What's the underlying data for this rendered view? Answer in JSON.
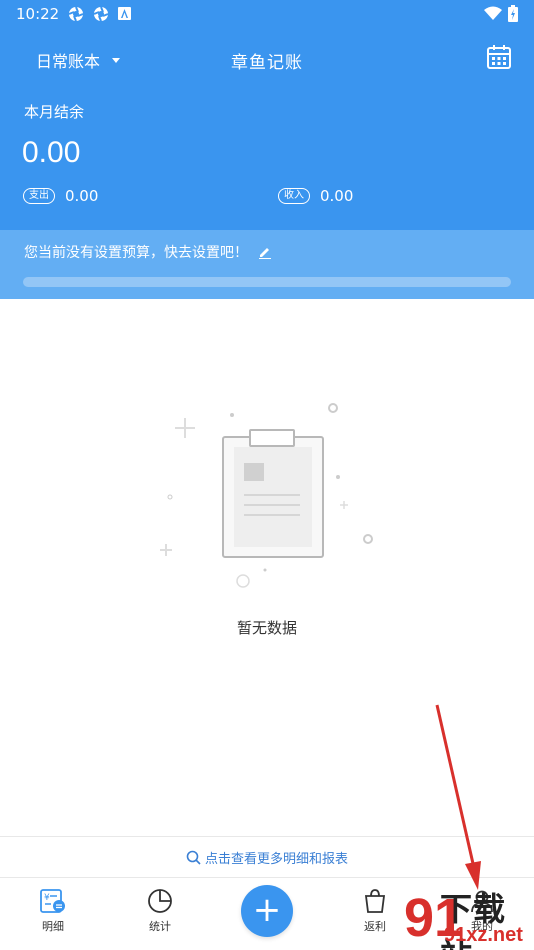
{
  "status_bar": {
    "time": "10:22"
  },
  "header": {
    "book_name": "日常账本",
    "app_title": "章鱼记账",
    "month_label": "本月结余",
    "balance": "0.00",
    "expense_label": "支出",
    "expense_value": "0.00",
    "income_label": "收入",
    "income_value": "0.00"
  },
  "budget": {
    "text": "您当前没有设置预算，快去设置吧！",
    "progress": 0
  },
  "empty": {
    "text": "暂无数据"
  },
  "more_link": "点击查看更多明细和报表",
  "tabs": {
    "details": "明细",
    "stats": "统计",
    "add": "+",
    "rebate": "返利",
    "mine": "我的"
  },
  "watermark": {
    "big": "下载站",
    "small": "91xz.net",
    "logo": "91"
  },
  "colors": {
    "primary": "#3a95ef",
    "budget_bg": "#63aef3",
    "arrow": "#d8302c"
  }
}
